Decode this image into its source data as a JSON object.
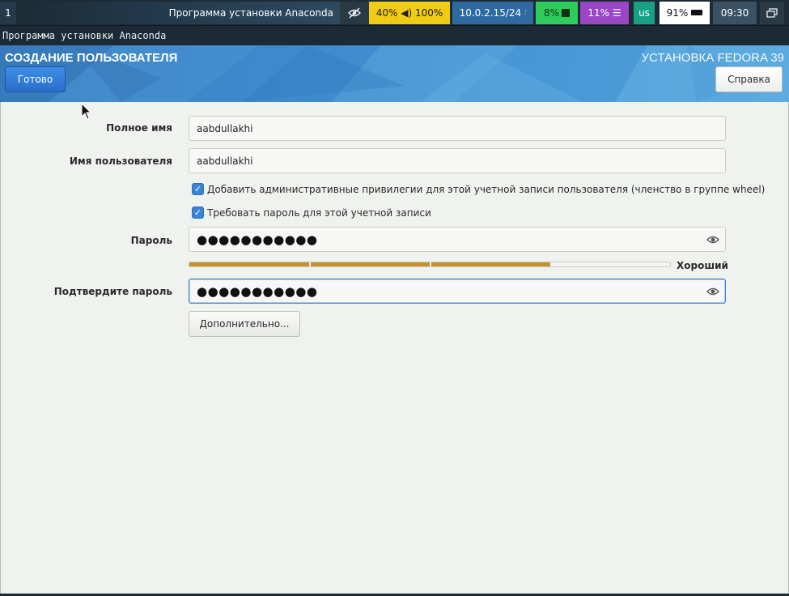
{
  "topbar": {
    "workspace": "1",
    "window_title": "Программа установки Anaconda",
    "eye_icon": "eye-slash-icon",
    "volume_text": "40% ◀) 100%",
    "network_text": "10.0.2.15/24",
    "cpu_text": "8%",
    "mem_text": "11% ☰",
    "keyboard_layout": "us",
    "battery_text": "91%",
    "time": "09:30",
    "colors": {
      "volume": "#f0cc14",
      "network": "#2e6aa0",
      "cpu": "#2ecc5a",
      "memory": "#9a46c6",
      "keyboard": "#16a085"
    }
  },
  "caption": {
    "title": "Программа установки Anaconda"
  },
  "header": {
    "title": "СОЗДАНИЕ ПОЛЬЗОВАТЕЛЯ",
    "product": "УСТАНОВКА FEDORA 39",
    "done_label": "Готово",
    "help_label": "Справка"
  },
  "form": {
    "fullname_label": "Полное имя",
    "fullname_value": "aabdullakhi",
    "username_label": "Имя пользователя",
    "username_value": "aabdullakhi",
    "admin_checkbox_label": "Добавить административные привилегии для этой учетной записи пользователя (членство в группе wheel)",
    "admin_checked": true,
    "require_password_label": "Требовать пароль для этой учетной записи",
    "require_password_checked": true,
    "password_label": "Пароль",
    "password_dots": "●●●●●●●●●●●",
    "strength_fraction": 0.75,
    "strength_label": "Хороший",
    "confirm_label": "Подтвердите пароль",
    "confirm_dots": "●●●●●●●●●●●",
    "advanced_label": "Дополнительно..."
  }
}
